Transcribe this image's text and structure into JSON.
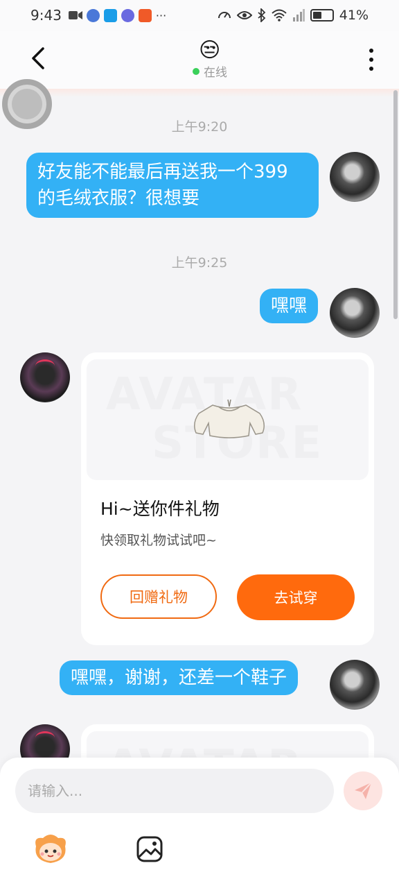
{
  "status_bar": {
    "time": "9:43",
    "dots": "···",
    "battery": "41%"
  },
  "header": {
    "status_emoji": "😒",
    "online_label": "在线"
  },
  "messages": [
    {
      "timestamp": "上午9:20"
    },
    {
      "text": "好友能不能最后再送我一个399的毛绒衣服？很想要",
      "line1": "好友能不能最后再送我一个399",
      "line2": "的毛绒衣服？很想要"
    },
    {
      "timestamp": "上午9:25"
    },
    {
      "text": "嘿嘿"
    },
    {
      "gift_card": {
        "watermark_top": "AVATAR",
        "watermark_bottom": "STORE",
        "title": "Hi~送你件礼物",
        "subtitle": "快领取礼物试试吧~",
        "return_button": "回赠礼物",
        "try_button": "去试穿"
      }
    },
    {
      "text": "嘿嘿，谢谢，还差一个鞋子"
    }
  ],
  "second_card": {
    "watermark_top": "AVATAR"
  },
  "input": {
    "placeholder": "请输入...",
    "value": ""
  },
  "colors": {
    "outgoing_bubble": "#33b1f5",
    "accent_orange": "#ff6a0d",
    "online_dot": "#3ad05a",
    "send_button_bg": "#fde4e1"
  },
  "icons": [
    "back-arrow-icon",
    "more-vertical-icon",
    "send-icon",
    "mascot-icon",
    "image-icon"
  ]
}
